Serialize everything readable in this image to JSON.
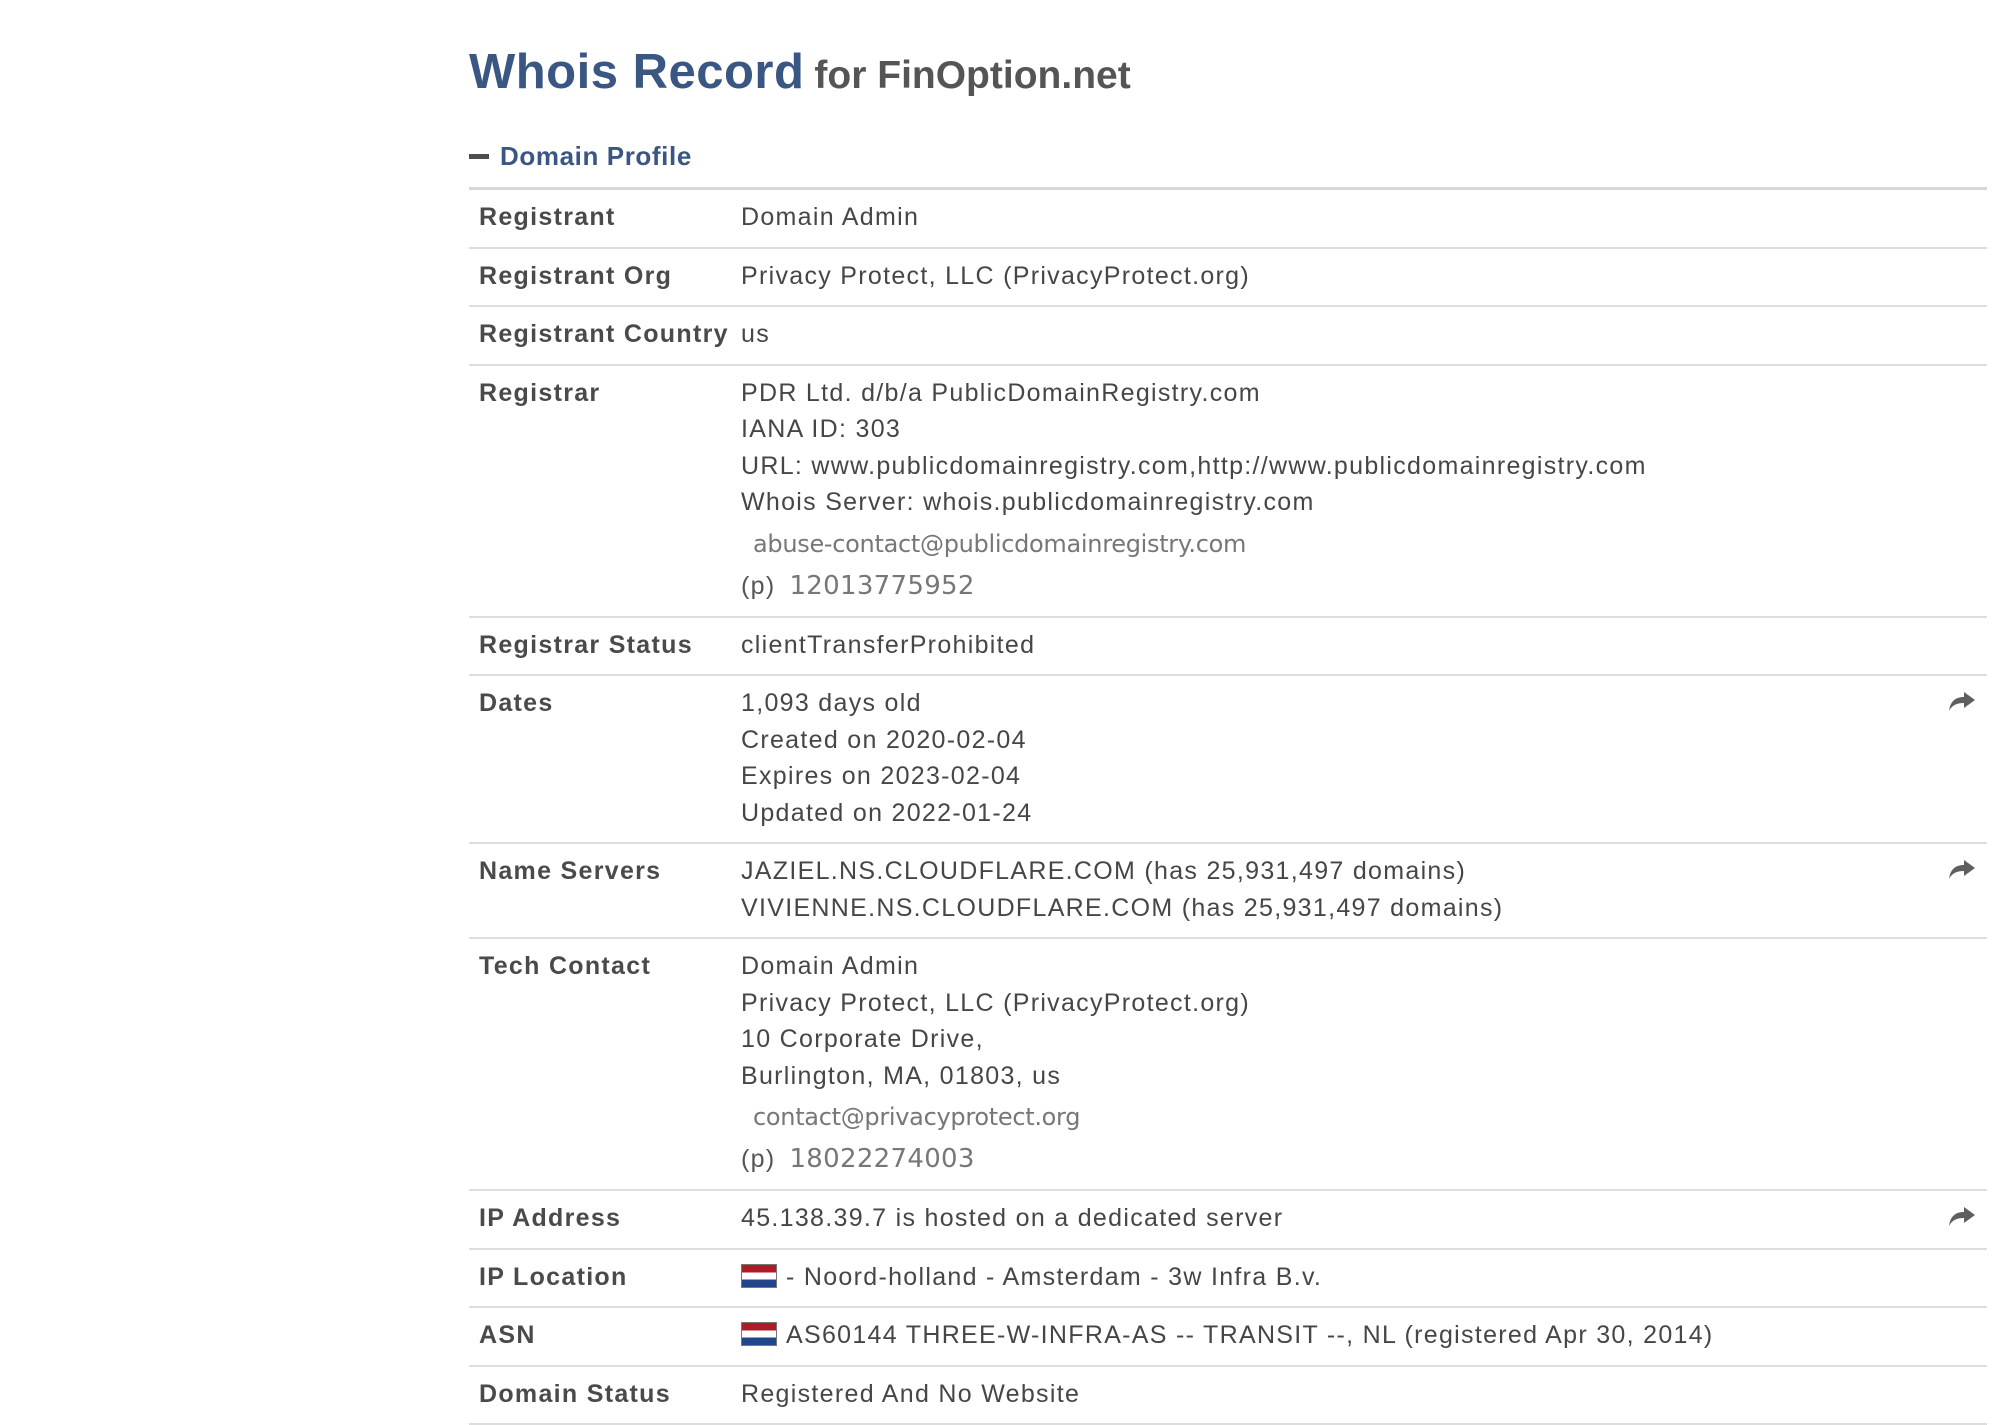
{
  "header": {
    "title": "Whois Record",
    "subtitle": "for FinOption.net"
  },
  "section": {
    "toggle_icon": "minus-icon",
    "label": "Domain Profile"
  },
  "rows": {
    "registrant": {
      "key": "Registrant",
      "value": "Domain Admin"
    },
    "registrant_org": {
      "key": "Registrant Org",
      "value": "Privacy Protect, LLC (PrivacyProtect.org)"
    },
    "registrant_country": {
      "key": "Registrant Country",
      "value": "us"
    },
    "registrar": {
      "key": "Registrar",
      "lines": [
        "PDR Ltd. d/b/a PublicDomainRegistry.com",
        "IANA ID: 303",
        "URL: www.publicdomainregistry.com,http://www.publicdomainregistry.com",
        "Whois Server: whois.publicdomainregistry.com"
      ],
      "email": "abuse-contact@publicdomainregistry.com",
      "phone_prefix": "(p)",
      "phone": "12013775952"
    },
    "registrar_status": {
      "key": "Registrar Status",
      "value": "clientTransferProhibited"
    },
    "dates": {
      "key": "Dates",
      "lines": [
        "1,093 days old",
        "Created on 2020-02-04",
        "Expires on 2023-02-04",
        "Updated on 2022-01-24"
      ],
      "action_icon": "share-arrow-icon"
    },
    "name_servers": {
      "key": "Name Servers",
      "lines": [
        "JAZIEL.NS.CLOUDFLARE.COM (has 25,931,497 domains)",
        "VIVIENNE.NS.CLOUDFLARE.COM (has 25,931,497 domains)"
      ],
      "action_icon": "share-arrow-icon"
    },
    "tech_contact": {
      "key": "Tech Contact",
      "lines": [
        "Domain Admin",
        "Privacy Protect, LLC (PrivacyProtect.org)",
        "10 Corporate Drive,",
        "Burlington, MA, 01803, us"
      ],
      "email": "contact@privacyprotect.org",
      "phone_prefix": "(p)",
      "phone": "18022274003"
    },
    "ip_address": {
      "key": "IP Address",
      "value": "45.138.39.7 is hosted on a dedicated server",
      "action_icon": "share-arrow-icon"
    },
    "ip_location": {
      "key": "IP Location",
      "flag_icon": "netherlands-flag-icon",
      "value": "- Noord-holland - Amsterdam - 3w Infra B.v."
    },
    "asn": {
      "key": "ASN",
      "flag_icon": "netherlands-flag-icon",
      "value": "AS60144 THREE-W-INFRA-AS -- TRANSIT --, NL (registered Apr 30, 2014)"
    },
    "domain_status": {
      "key": "Domain Status",
      "value": "Registered And No Website"
    }
  },
  "colors": {
    "title": "#3a5683",
    "section_label": "#3a5683",
    "text": "#464646",
    "row_divider": "#dddddd",
    "flag_red": "#ae1c28",
    "flag_blue": "#21468b"
  }
}
